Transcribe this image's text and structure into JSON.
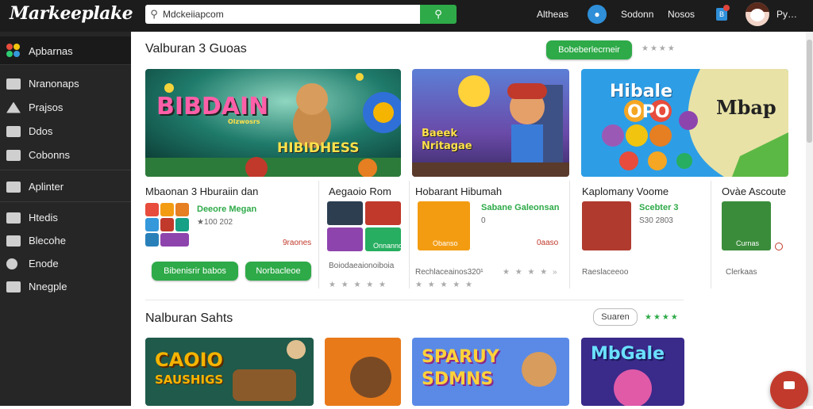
{
  "app": {
    "logo": "Markeeplake"
  },
  "search": {
    "value": "Mdckeiiapcom",
    "placeholder": "Mdckeiiapcom"
  },
  "topnav": {
    "link1": "Altheas",
    "link2": "Sodonn",
    "link3": "Nosos",
    "user": "Py…"
  },
  "sidebar": {
    "items": [
      {
        "label": "Apbarnas",
        "icon": "puzzle-icon"
      },
      {
        "label": "Nranonaps",
        "icon": "inbox-icon"
      },
      {
        "label": "Prajsos",
        "icon": "gamepad-icon"
      },
      {
        "label": "Ddos",
        "icon": "folder-icon"
      },
      {
        "label": "Cobonns",
        "icon": "users-icon"
      },
      {
        "label": "Aplinter",
        "icon": "upload-icon"
      },
      {
        "label": "Htedis",
        "icon": "chart-icon"
      },
      {
        "label": "Blecohe",
        "icon": "mail-icon"
      },
      {
        "label": "Enode",
        "icon": "globe-icon"
      },
      {
        "label": "Nnegple",
        "icon": "chat-icon"
      }
    ]
  },
  "section1": {
    "title": "Valburan 3 Guoas",
    "button": "Bobeberlecrneir",
    "banners": [
      {
        "title": "BIBDAIN",
        "sub": "HIBIDHESS",
        "tag": "Olzwosrs"
      },
      {
        "title": "Baeek",
        "sub": "Nritagae"
      },
      {
        "title": "Hibale",
        "sub": "OPO",
        "tag": "Mbap"
      }
    ],
    "cards": [
      {
        "title": "Mbaonan 3 Hburaiin dan",
        "sub_green": "Deeore Megan",
        "sub_gray": "★100 202",
        "sub_red": "9raones",
        "btn1": "Bibenisrir babos",
        "btn2": "Norbacleoe"
      },
      {
        "title": "Aegaoio Rom",
        "tile_label": "Onnanno",
        "foot": "Boiodaeaionoiboia",
        "stars": "★ ★ ★ ★ ★"
      },
      {
        "title": "Hobarant Hibumah",
        "sub_green": "Sabane Galeonsan",
        "sub_gray": "0",
        "tile_label": "Obanso",
        "sub_red": "0aaso",
        "foot": "Rechlaceainos320¹",
        "stars": "★ ★ ★ ★ »",
        "stars2": "★ ★ ★ ★ ★"
      },
      {
        "title": "Kaplomany Voome",
        "sub_green": "Scebter 3",
        "sub_gray": "S30 2803",
        "foot": "Raeslaceeoo"
      },
      {
        "title": "Ovàe Ascoute",
        "tile_label": "Curnas",
        "foot": "Clerkaas"
      }
    ]
  },
  "section2": {
    "title": "Nalburan Sahts",
    "button": "Suaren",
    "banners": [
      {
        "title": "CAOIO",
        "sub": "SAUSHIGS"
      },
      {
        "title": ""
      },
      {
        "title": "SPARUY",
        "sub": "SDMNS"
      },
      {
        "title": "MbGale"
      }
    ]
  },
  "colors": {
    "accent": "#2eaa48",
    "topbar": "#1c1c1c",
    "sidebar": "#262626",
    "danger": "#c13a2c"
  }
}
